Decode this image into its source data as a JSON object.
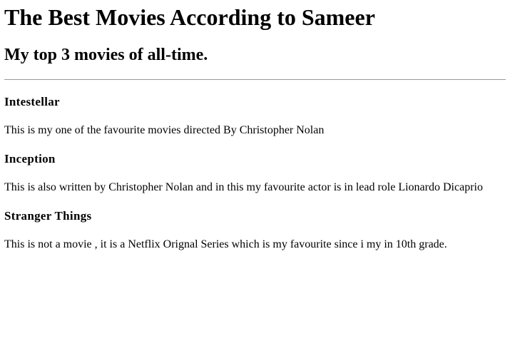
{
  "title": "The Best Movies According to Sameer",
  "subtitle": "My top 3 movies of all-time.",
  "movies": [
    {
      "name": "Intestellar",
      "description": "This is my one of the favourite movies directed By Christopher Nolan"
    },
    {
      "name": "Inception",
      "description": "This is also written by Christopher Nolan and in this my favourite actor is in lead role Lionardo Dicaprio"
    },
    {
      "name": "Stranger Things",
      "description": "This is not a movie , it is a Netflix Orignal Series which is my favourite since i my in 10th grade."
    }
  ]
}
